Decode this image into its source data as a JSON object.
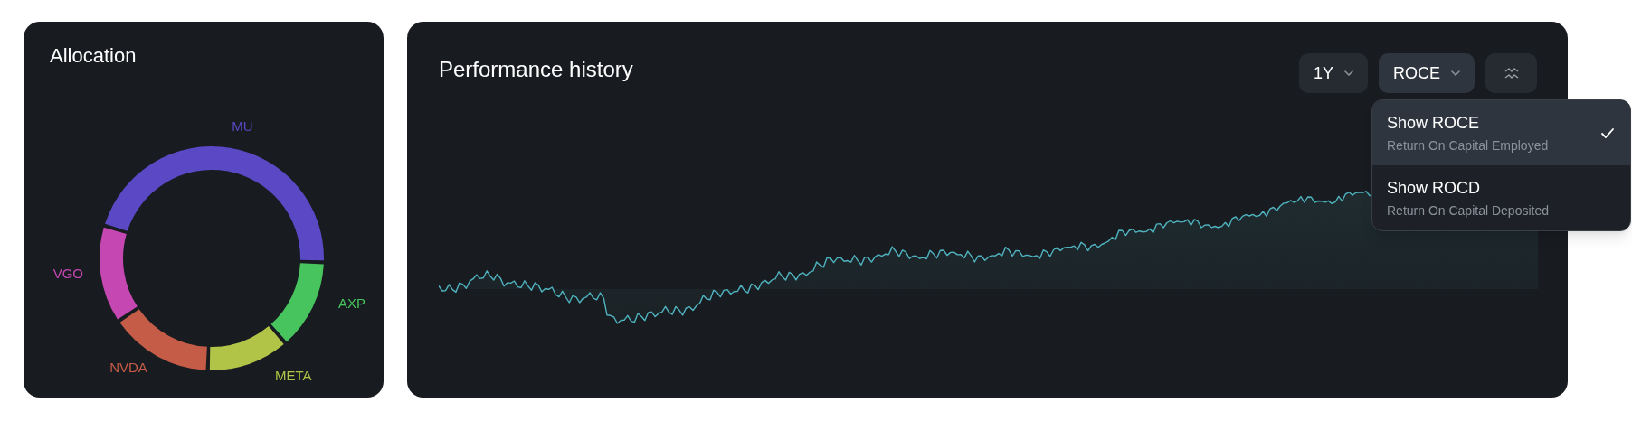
{
  "allocation": {
    "title": "Allocation",
    "segments": [
      {
        "label": "MU",
        "color": "#5b48c4"
      },
      {
        "label": "AXP",
        "color": "#47c45e"
      },
      {
        "label": "META",
        "color": "#b2c447"
      },
      {
        "label": "NVDA",
        "color": "#c45c47"
      },
      {
        "label": "VGO",
        "color": "#c447b2"
      }
    ]
  },
  "performance": {
    "title": "Performance history",
    "controls": [
      {
        "kind": "dropdown",
        "label": "1Y",
        "expanded": false
      },
      {
        "kind": "dropdown",
        "label": "ROCE",
        "expanded": true
      },
      {
        "kind": "icon"
      }
    ],
    "menu": [
      {
        "title": "Show ROCE",
        "subtitle": "Return On Capital Employed",
        "selected": true
      },
      {
        "title": "Show ROCD",
        "subtitle": "Return On Capital Deposited",
        "selected": false
      }
    ]
  }
}
